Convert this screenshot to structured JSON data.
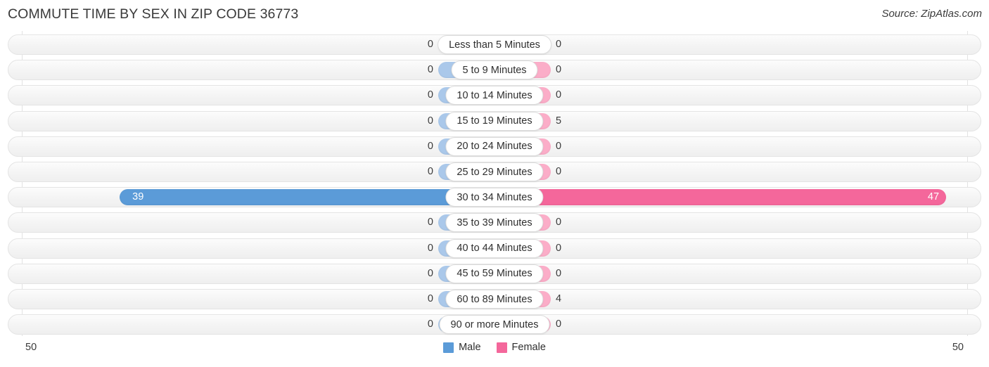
{
  "header": {
    "title": "COMMUTE TIME BY SEX IN ZIP CODE 36773",
    "source": "Source: ZipAtlas.com"
  },
  "legend": {
    "male_label": "Male",
    "female_label": "Female",
    "male_color": "#5b9bd8",
    "female_color": "#f4679b",
    "male_color_light": "#aac8ea",
    "female_color_light": "#fbadc8"
  },
  "axis": {
    "left_max": "50",
    "right_max": "50",
    "max_value": 50
  },
  "chart_data": {
    "type": "bar",
    "title": "COMMUTE TIME BY SEX IN ZIP CODE 36773",
    "subtitle": "Source: ZipAtlas.com",
    "orientation": "horizontal-diverging",
    "xlabel": "",
    "ylabel": "",
    "xlim": [
      50,
      50
    ],
    "grid": true,
    "legend_position": "bottom-center",
    "categories": [
      "Less than 5 Minutes",
      "5 to 9 Minutes",
      "10 to 14 Minutes",
      "15 to 19 Minutes",
      "20 to 24 Minutes",
      "25 to 29 Minutes",
      "30 to 34 Minutes",
      "35 to 39 Minutes",
      "40 to 44 Minutes",
      "45 to 59 Minutes",
      "60 to 89 Minutes",
      "90 or more Minutes"
    ],
    "series": [
      {
        "name": "Male",
        "values": [
          0,
          0,
          0,
          0,
          0,
          0,
          39,
          0,
          0,
          0,
          0,
          0
        ],
        "labels": [
          "0",
          "0",
          "0",
          "0",
          "0",
          "0",
          "39",
          "0",
          "0",
          "0",
          "0",
          "0"
        ]
      },
      {
        "name": "Female",
        "values": [
          0,
          0,
          0,
          5,
          0,
          0,
          47,
          0,
          0,
          0,
          4,
          0
        ],
        "labels": [
          "0",
          "0",
          "0",
          "5",
          "0",
          "0",
          "47",
          "0",
          "0",
          "0",
          "4",
          "0"
        ]
      }
    ]
  }
}
